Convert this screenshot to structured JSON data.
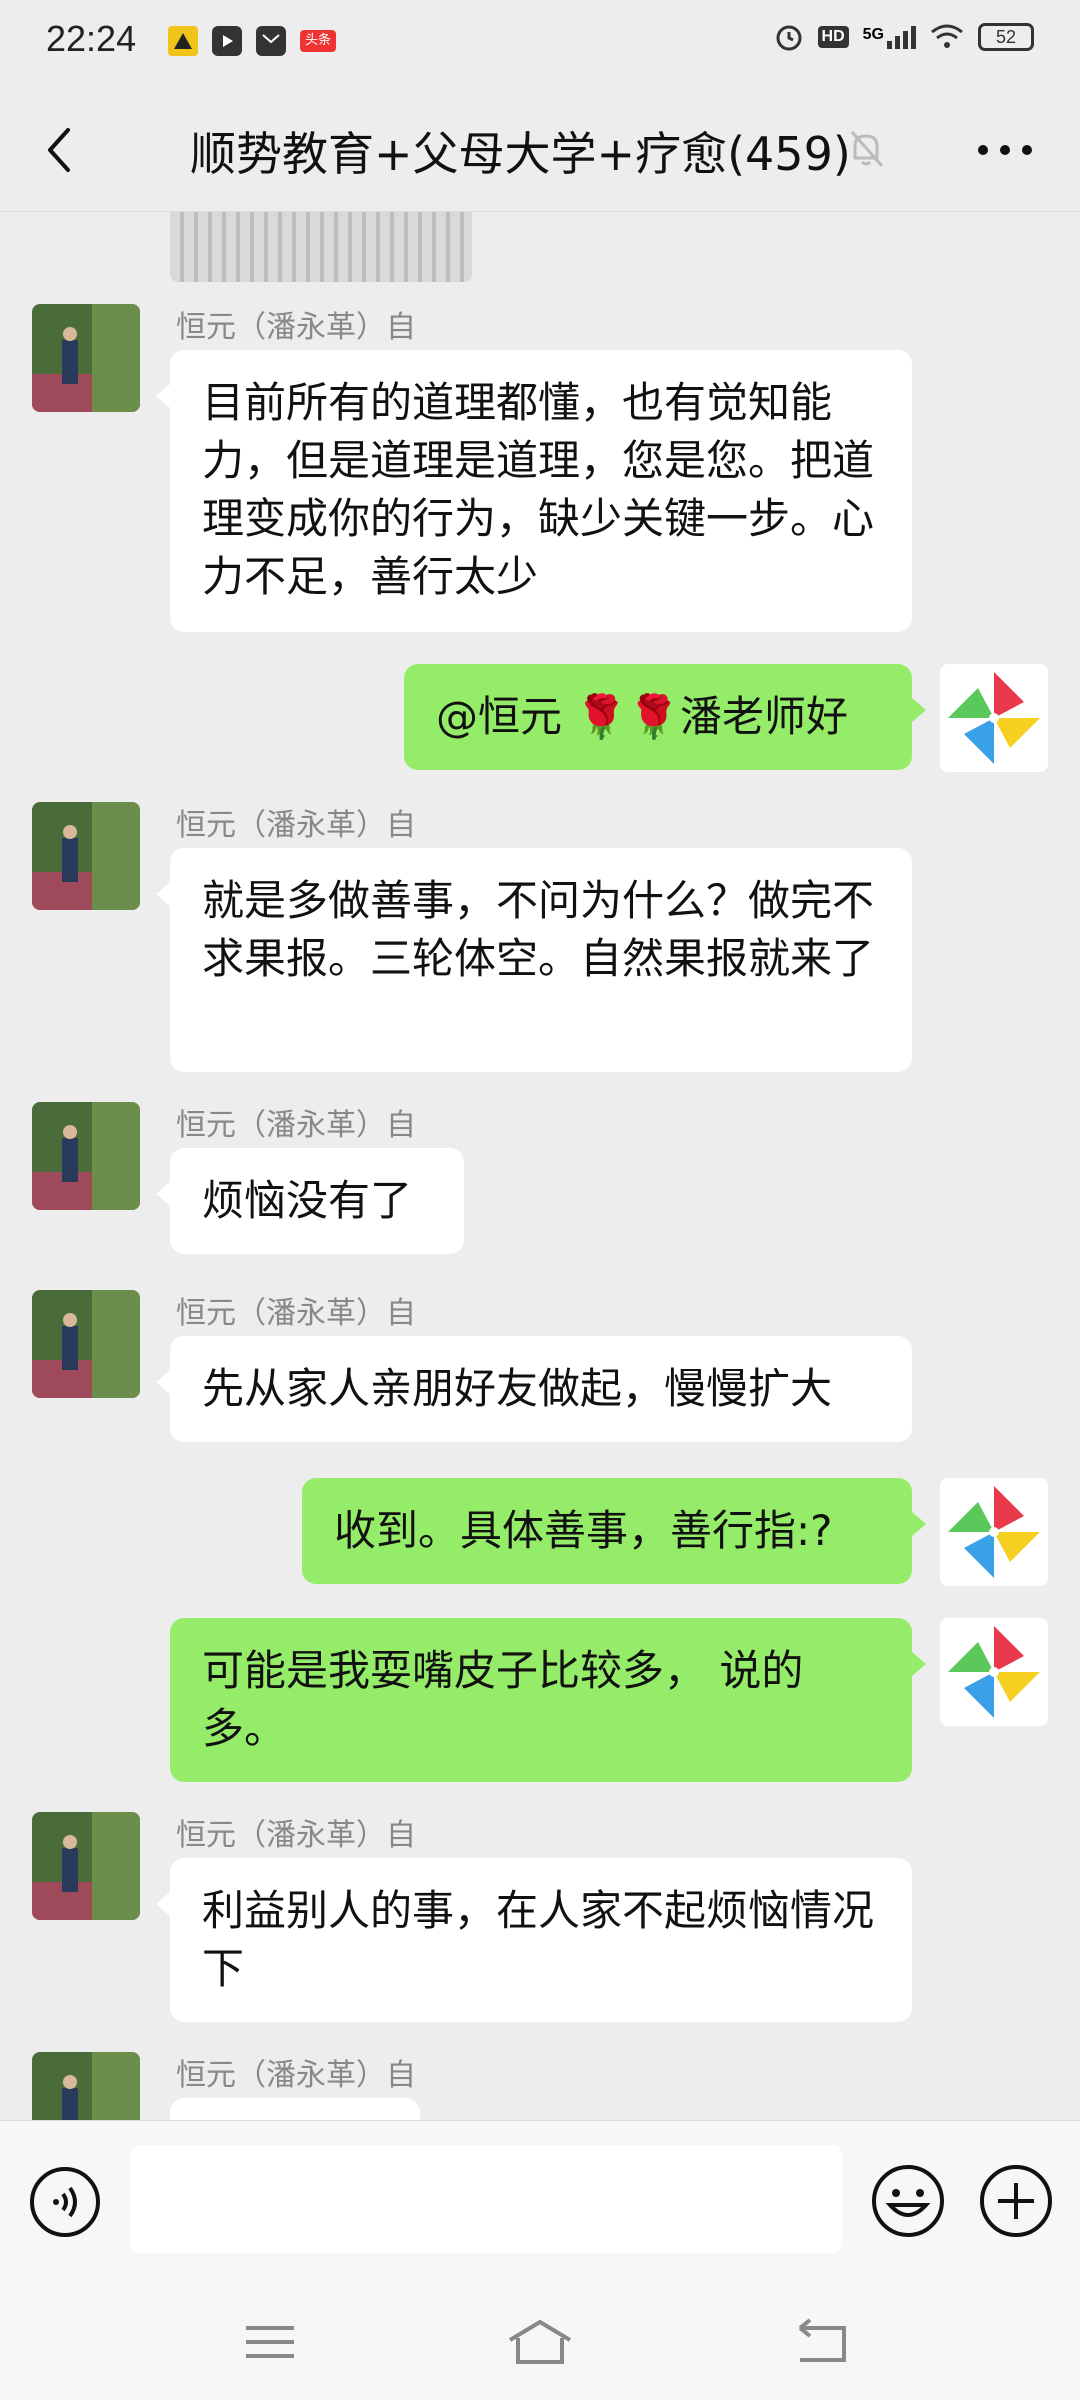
{
  "status_bar": {
    "time": "22:24",
    "left_icons": [
      "warning-icon",
      "play-icon",
      "mail-icon",
      "news-icon"
    ],
    "news_badge": "头条",
    "network": "5G",
    "hd": "HD",
    "battery": "52"
  },
  "header": {
    "title": "顺势教育+父母大学+疗愈(459)"
  },
  "messages": [
    {
      "dir": "in",
      "sender": "恒元（潘永革）自",
      "text": "目前所有的道理都懂，也有觉知能力，但是道理是道理，您是您。把道理变成你的行为，缺少关键一步。心力不足，善行太少"
    },
    {
      "dir": "out",
      "text": "@恒元 🌹🌹潘老师好"
    },
    {
      "dir": "in",
      "sender": "恒元（潘永革）自",
      "text": "就是多做善事，不问为什么？做完不求果报。三轮体空。自然果报就来了"
    },
    {
      "dir": "in",
      "sender": "恒元（潘永革）自",
      "text": "烦恼没有了"
    },
    {
      "dir": "in",
      "sender": "恒元（潘永革）自",
      "text": "先从家人亲朋好友做起，慢慢扩大"
    },
    {
      "dir": "out",
      "text": "收到。具体善事，善行指:?"
    },
    {
      "dir": "out",
      "text": "可能是我耍嘴皮子比较多， 说的多。"
    },
    {
      "dir": "in",
      "sender": "恒元（潘永革）自",
      "text": "利益别人的事，在人家不起烦恼情况下"
    },
    {
      "dir": "in",
      "sender": "恒元（潘永革）自",
      "text": ""
    }
  ],
  "input": {
    "value": "",
    "placeholder": ""
  },
  "colors": {
    "background": "#ededed",
    "bubble_out": "#95ec69",
    "bubble_in": "#ffffff"
  }
}
